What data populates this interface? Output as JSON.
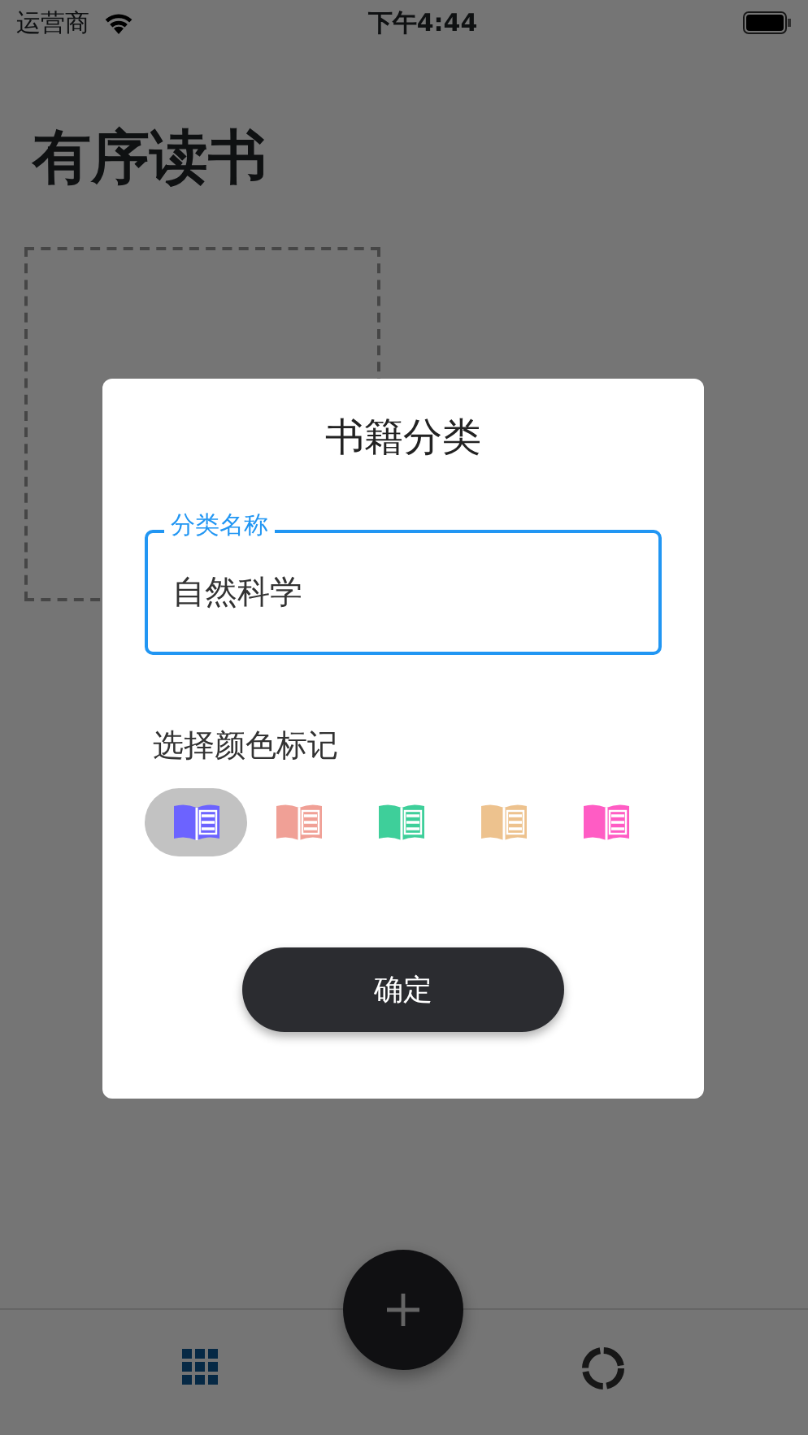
{
  "status_bar": {
    "carrier": "运营商",
    "time": "下午4:44"
  },
  "title": "有序读书",
  "dialog": {
    "title": "书籍分类",
    "field": {
      "label": "分类名称",
      "value": "自然科学"
    },
    "color_label": "选择颜色标记",
    "colors": [
      {
        "color": "#6c63ff",
        "selected": true
      },
      {
        "color": "#f0a096",
        "selected": false
      },
      {
        "color": "#3ecf9a",
        "selected": false
      },
      {
        "color": "#edc28e",
        "selected": false
      },
      {
        "color": "#ff5cc4",
        "selected": false
      }
    ],
    "button": "确定"
  },
  "tab_bar": {
    "tabs": [
      {
        "kind": "grid",
        "selected": true
      },
      {
        "kind": "ring",
        "selected": false
      }
    ]
  }
}
